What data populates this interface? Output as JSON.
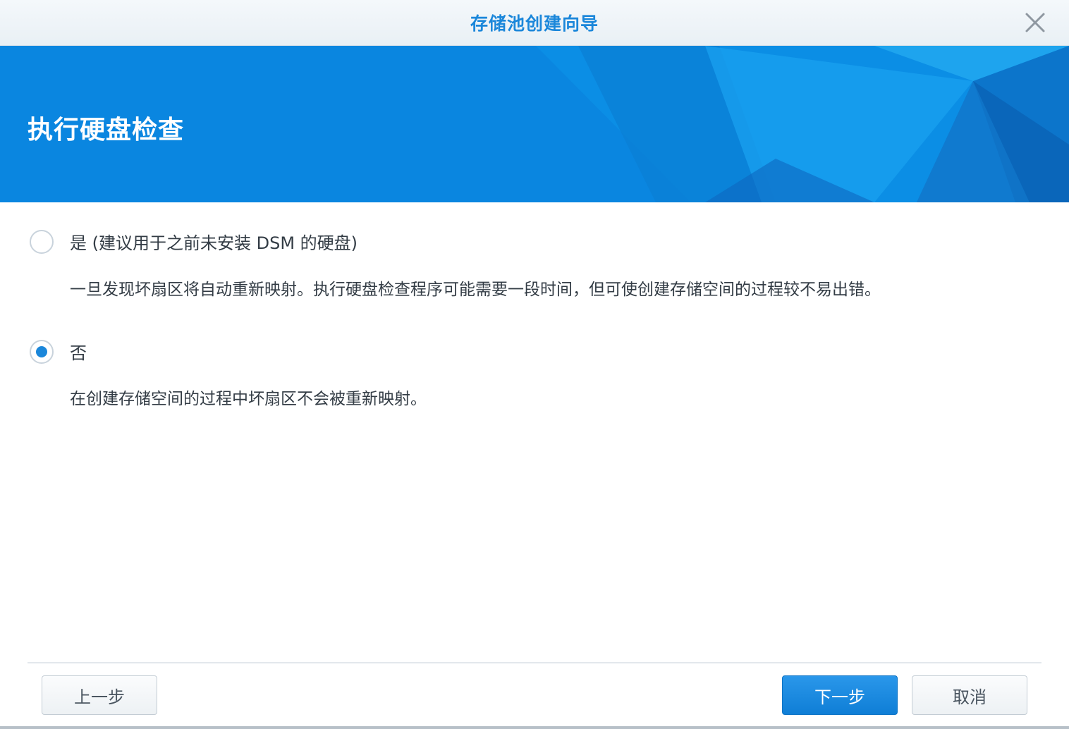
{
  "window": {
    "title": "存储池创建向导",
    "close_icon": "close-icon"
  },
  "banner": {
    "title": "执行硬盘检查",
    "color": "#0a86e0"
  },
  "options": [
    {
      "label": "是 (建议用于之前未安装 DSM 的硬盘)",
      "description": "一旦发现坏扇区将自动重新映射。执行硬盘检查程序可能需要一段时间，但可使创建存储空间的过程较不易出错。",
      "selected": false
    },
    {
      "label": "否",
      "description": "在创建存储空间的过程中坏扇区不会被重新映射。",
      "selected": true
    }
  ],
  "footer": {
    "back_label": "上一步",
    "next_label": "下一步",
    "cancel_label": "取消"
  },
  "colors": {
    "accent": "#1b87da",
    "text": "#333c45"
  }
}
